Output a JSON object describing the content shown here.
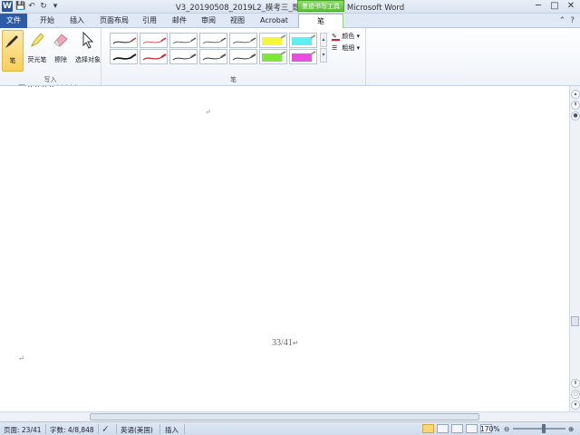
{
  "window": {
    "title": "V3_20190508_2019L2_模考三_题目_XPL_LZ - Microsoft Word",
    "app_logo": "W",
    "context_tab_header": "墨迹书写工具",
    "controls": [
      "─",
      "□",
      "✕"
    ]
  },
  "tabs": {
    "file": "文件",
    "items": [
      "开始",
      "插入",
      "页面布局",
      "引用",
      "邮件",
      "审阅",
      "视图",
      "Acrobat"
    ],
    "active": "笔"
  },
  "ribbon": {
    "write_group_label": "写入",
    "pen_group_label": "笔",
    "tools": {
      "pen": "笔",
      "highlighter": "荧光笔",
      "eraser": "擦除",
      "select": "选择对象"
    },
    "color_label": "颜色",
    "thickness_label": "粗细",
    "highlight_colors": [
      "#f5f53a",
      "#5df0ee",
      "#7de83a",
      "#e84fe0"
    ]
  },
  "document": {
    "page_number": "33/41",
    "paragraph_mark": "↵"
  },
  "statusbar": {
    "page": "页面: 23/41",
    "words": "字数: 4/8,848",
    "language": "英语(美国)",
    "mode": "插入",
    "zoom": "170%"
  }
}
